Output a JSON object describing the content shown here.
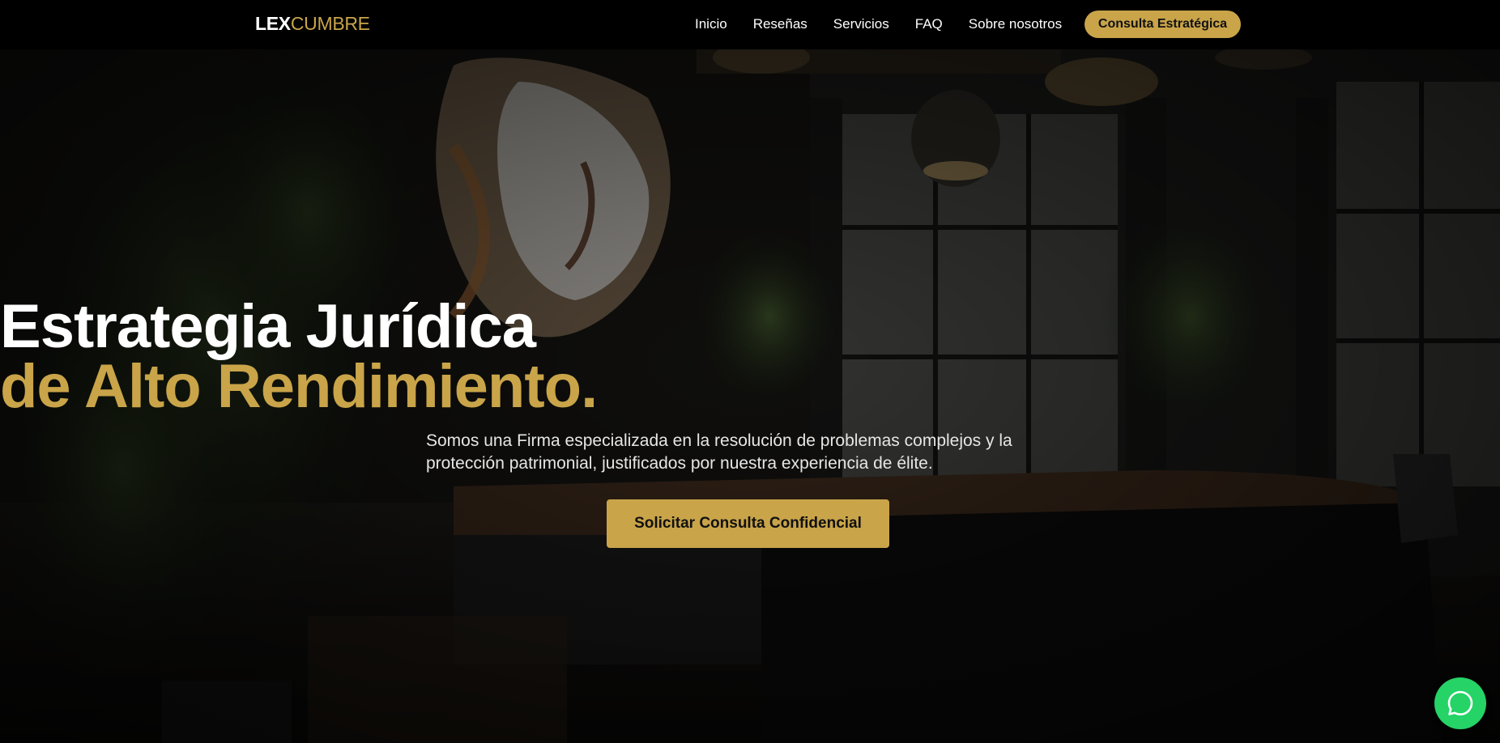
{
  "nav": {
    "logo_part1": "LEX",
    "logo_part2": "CUMBRE",
    "links": [
      "Inicio",
      "Reseñas",
      "Servicios",
      "FAQ",
      "Sobre nosotros"
    ],
    "cta_label": "Consulta Estratégica"
  },
  "hero": {
    "title_line1": "Estrategia Jurídica",
    "title_line2": "de Alto Rendimiento.",
    "subtitle": "Somos una Firma especializada en la resolución de problemas complejos y la protección patrimonial, justificados por nuestra experiencia de élite.",
    "button_label": "Solicitar Consulta Confidencial"
  },
  "floating": {
    "whatsapp_icon": "whatsapp-icon"
  },
  "colors": {
    "accent_gold": "#c9a449",
    "navbar_bg": "#000000",
    "whatsapp_green": "#25d366"
  }
}
